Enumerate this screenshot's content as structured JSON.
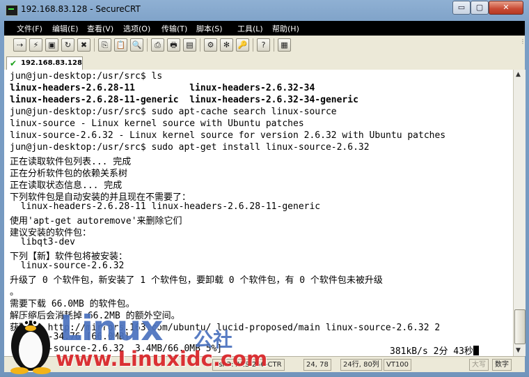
{
  "window": {
    "title": "192.168.83.128 - SecureCRT",
    "buttons": {
      "minimize": "▭",
      "maximize": "▢",
      "close": "✕"
    }
  },
  "menu": [
    "文件(F)",
    "编辑(E)",
    "查看(V)",
    "选项(O)",
    "传输(T)",
    "脚本(S)",
    "工具(L)",
    "帮助(H)"
  ],
  "toolbar": {
    "icons": [
      "connect-icon",
      "quick-connect-icon",
      "connect-tab-icon",
      "reconnect-icon",
      "disconnect-icon",
      "copy-icon",
      "paste-icon",
      "find-icon",
      "print-setup-icon",
      "print-icon",
      "print-screen-icon",
      "session-options-icon",
      "global-options-icon",
      "keymap-icon",
      "help-icon",
      "sftp-icon"
    ],
    "glyphs": [
      "⇢",
      "⚡",
      "▣",
      "↻",
      "✖",
      "⎘",
      "📋",
      "🔍",
      "⎙",
      "🖶",
      "▤",
      "⚙",
      "✻",
      "🔑",
      "?",
      "▦"
    ]
  },
  "tab": {
    "label": "192.168.83.128",
    "status": "connected"
  },
  "terminal": {
    "lines": [
      {
        "text": "jun@jun-desktop:/usr/src$ ls",
        "bold": false
      },
      {
        "text": "linux-headers-2.6.28-11          linux-headers-2.6.32-34",
        "bold": true
      },
      {
        "text": "linux-headers-2.6.28-11-generic  linux-headers-2.6.32-34-generic",
        "bold": true
      },
      {
        "text": "jun@jun-desktop:/usr/src$ sudo apt-cache search linux-source",
        "bold": false
      },
      {
        "text": "linux-source - Linux kernel source with Ubuntu patches",
        "bold": false
      },
      {
        "text": "linux-source-2.6.32 - Linux kernel source for version 2.6.32 with Ubuntu patches",
        "bold": false
      },
      {
        "text": "jun@jun-desktop:/usr/src$ sudo apt-get install linux-source-2.6.32",
        "bold": false
      },
      {
        "text": "正在读取软件包列表... 完成",
        "bold": false
      },
      {
        "text": "正在分析软件包的依赖关系树",
        "bold": false
      },
      {
        "text": "正在读取状态信息... 完成",
        "bold": false
      },
      {
        "text": "下列软件包是自动安装的并且现在不需要了：",
        "bold": false
      },
      {
        "text": "  linux-headers-2.6.28-11 linux-headers-2.6.28-11-generic",
        "bold": false
      },
      {
        "text": "使用'apt-get autoremove'来删除它们",
        "bold": false
      },
      {
        "text": "建议安装的软件包：",
        "bold": false
      },
      {
        "text": "  libqt3-dev",
        "bold": false
      },
      {
        "text": "下列【新】软件包将被安装：",
        "bold": false
      },
      {
        "text": "  linux-source-2.6.32",
        "bold": false
      },
      {
        "text": "升级了 0 个软件包，新安装了 1 个软件包，要卸载 0 个软件包，有 0 个软件包未被升级",
        "bold": false
      },
      {
        "text": "。",
        "bold": false
      },
      {
        "text": "需要下载 66.0MB 的软件包。",
        "bold": false
      },
      {
        "text": "解压缩后会消耗掉 66.2MB 的额外空间。",
        "bold": false
      },
      {
        "text": "获取：1 http://mirrors.163.com/ubuntu/ lucid-proposed/main linux-source-2.6.32 2",
        "bold": false
      },
      {
        "text": "  .6.32-34.76 [66.0MB]",
        "bold": false
      },
      {
        "text": "  linux-source-2.6.32  3.4MB/66.0MB 5%]",
        "bold": false,
        "right": "381kB/s 2分 43秒"
      }
    ]
  },
  "status": {
    "cipher": "ssh2: AES-256-CTR",
    "position": "24,  78",
    "size": "24行, 80列",
    "emulation": "VT100",
    "caps": "大写",
    "num": "数字"
  },
  "watermark": {
    "brand": "Linux",
    "brand_cn": "公社",
    "url": "www.Linuxidc.com"
  }
}
